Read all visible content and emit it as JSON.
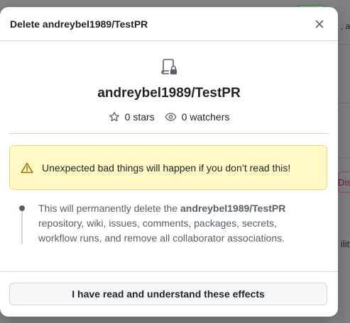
{
  "background": {
    "snippet_top": ", ar",
    "snippet_danger": "Dis",
    "snippet_mid": "ility"
  },
  "dialog": {
    "title": "Delete andreybel1989/TestPR",
    "close_icon": "x-icon",
    "repo_icon": "repo-locked-icon",
    "repo_name": "andreybel1989/TestPR",
    "stars_label": "0 stars",
    "watchers_label": "0 watchers",
    "warning_text": "Unexpected bad things will happen if you don’t read this!",
    "effect_prefix": "This will permanently delete the ",
    "effect_repo": "andreybel1989/TestPR",
    "effect_suffix": " repository, wiki, issues, comments, packages, secrets, workflow runs, and remove all collaborator associations.",
    "confirm_button": "I have read and understand these effects"
  },
  "colors": {
    "warning_bg": "#fff8c5",
    "warning_icon": "#9a6700",
    "muted_text": "#57606a",
    "border": "#d0d7de"
  }
}
